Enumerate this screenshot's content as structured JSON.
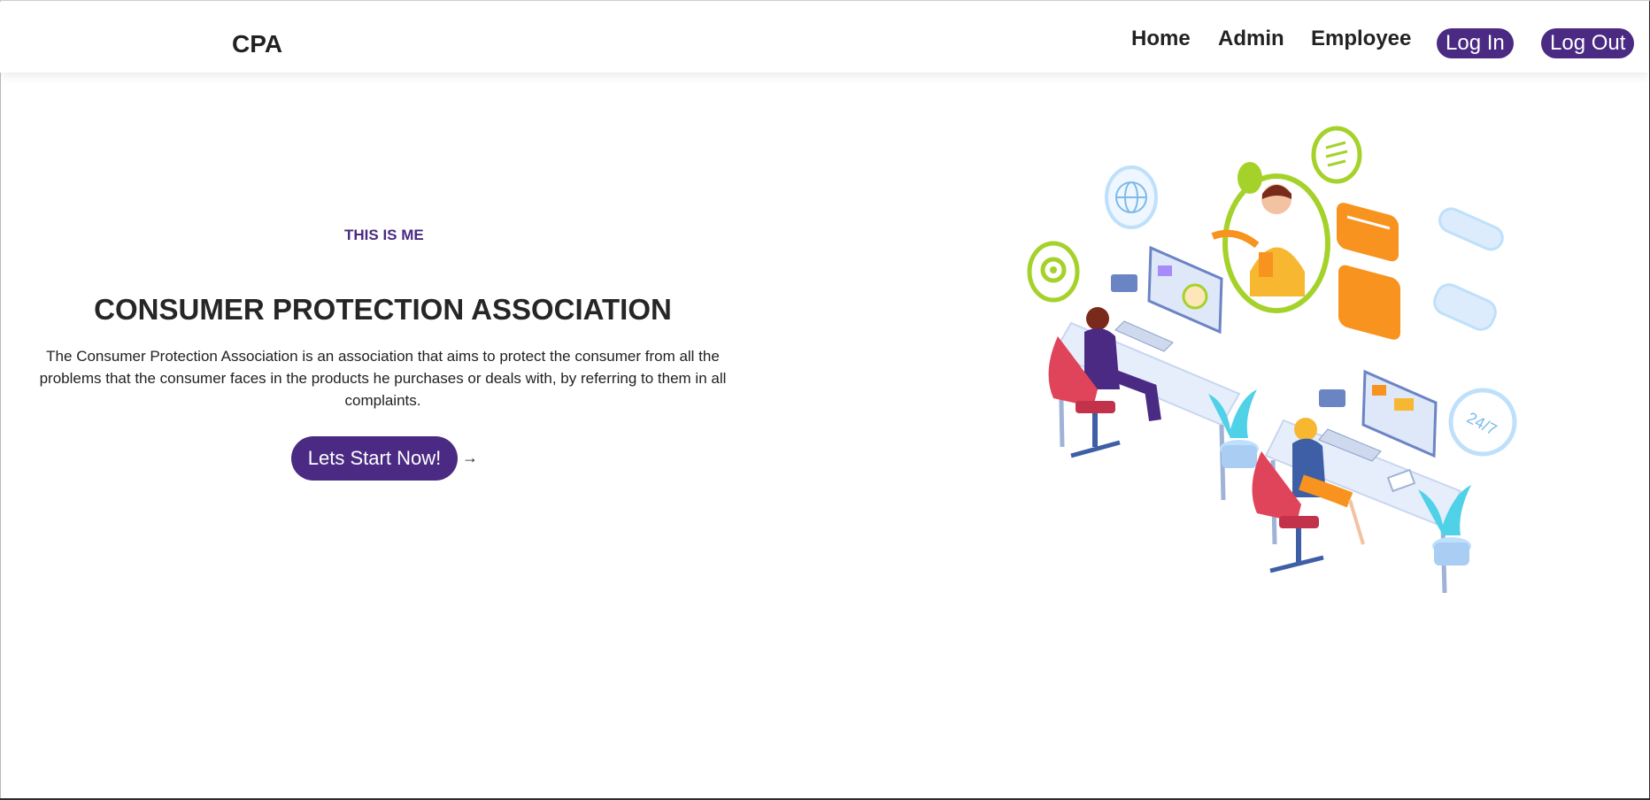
{
  "header": {
    "brand": "CPA",
    "nav": {
      "home": "Home",
      "admin": "Admin",
      "employee": "Employee",
      "login": "Log In",
      "logout": "Log Out"
    }
  },
  "hero": {
    "eyebrow": "THIS IS ME",
    "title": "CONSUMER PROTECTION ASSOCIATION",
    "description": "The Consumer Protection Association is an association that aims to protect the consumer from all the problems that the consumer faces in the products he purchases or deals with, by referring to them in all complaints.",
    "cta_label": "Lets Start Now!",
    "cta_arrow": "→"
  },
  "illustration": {
    "badge_text": "24/7"
  },
  "colors": {
    "accent": "#4a2a82",
    "chair": "#e0445a",
    "desk": "#dfe8f8",
    "orange": "#f7931e",
    "green": "#a5d22a",
    "lightblue": "#bfe0fb"
  }
}
